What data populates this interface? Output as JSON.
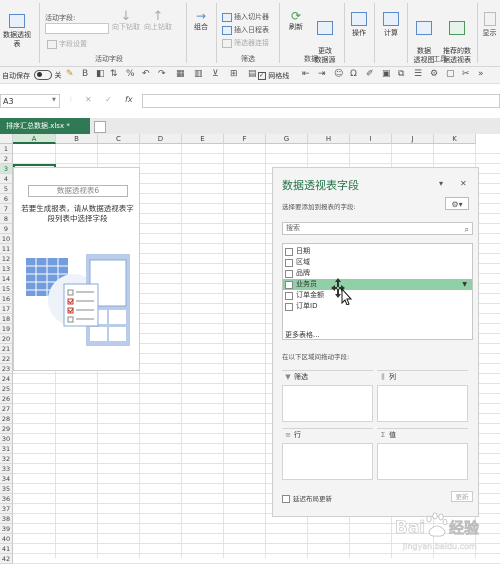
{
  "ribbon": {
    "pivot_table_name_label": "数据透视表",
    "active_field_label": "活动字段:",
    "field_settings_label": "字段设置",
    "drill_down_label": "向下钻取",
    "drill_up_label": "向上钻取",
    "active_field_group": "活动字段",
    "group_label": "组合",
    "insert_slicer_label": "插入切片器",
    "insert_timeline_label": "插入日程表",
    "filter_connections_label": "筛选器连接",
    "filter_group": "筛选",
    "refresh_label": "刷新",
    "change_data_source_label": "更改\n数据源",
    "data_group": "数据",
    "actions_label": "操作",
    "calculations_label": "计算",
    "pivot_chart_label": "数据\n透视图",
    "recommended_pivot_label": "推荐的数\n据透视表",
    "tools_group": "工具",
    "show_label": "显示"
  },
  "qat": {
    "autosave_label": "自动保存",
    "autosave_state": "关",
    "gridlines_label": "网格线"
  },
  "formula_bar": {
    "name_box": "A3",
    "fx": "fx",
    "cancel": "✕",
    "confirm": "✓"
  },
  "file_tab": {
    "name": "排序汇总数据.xlsx *"
  },
  "grid": {
    "columns": [
      "A",
      "B",
      "C",
      "D",
      "E",
      "F",
      "G",
      "H",
      "I",
      "J",
      "K"
    ],
    "rows": [
      "1",
      "2",
      "3",
      "4",
      "5",
      "6",
      "7",
      "8",
      "9",
      "10",
      "11",
      "12",
      "13",
      "14",
      "15",
      "16",
      "17",
      "18",
      "19",
      "20",
      "21",
      "22",
      "23",
      "24",
      "25",
      "26",
      "27",
      "28",
      "29",
      "30",
      "31",
      "32",
      "33",
      "34",
      "35",
      "36",
      "37",
      "38",
      "39",
      "40",
      "41",
      "42"
    ],
    "selected_cell": "A3"
  },
  "pivot_placeholder": {
    "title": "数据透视表6",
    "instruction": "若要生成报表，请从数据透视表字段列表中选择字段"
  },
  "pivot_pane": {
    "title": "数据透视表字段",
    "subtitle": "选择要添加到报表的字段:",
    "search_placeholder": "搜索",
    "fields": [
      {
        "label": "日期",
        "checked": false
      },
      {
        "label": "区域",
        "checked": false
      },
      {
        "label": "品牌",
        "checked": false
      },
      {
        "label": "业务员",
        "checked": false,
        "highlighted": true
      },
      {
        "label": "订单金额",
        "checked": false
      },
      {
        "label": "订单ID",
        "checked": false
      }
    ],
    "more_tables": "更多表格...",
    "areas_hint": "在以下区域间拖动字段:",
    "areas": {
      "filters": "筛选",
      "columns": "列",
      "rows": "行",
      "values": "值"
    },
    "defer_update_label": "延迟布局更新",
    "update_button": "更新"
  },
  "watermark": {
    "text": "Bai经验",
    "sub": "jingyan.baidu.com"
  }
}
